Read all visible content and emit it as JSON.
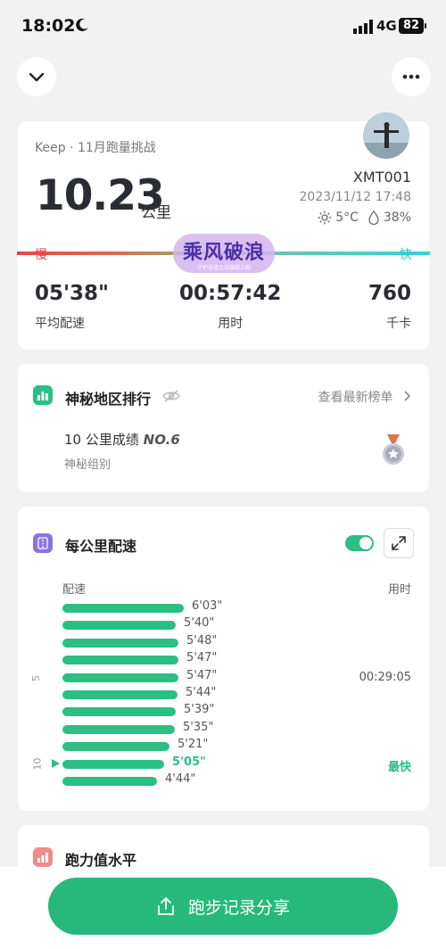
{
  "status_bar": {
    "time": "18:02",
    "network": "4G",
    "battery": "82"
  },
  "summary": {
    "challenge": "Keep · 11月跑量挑战",
    "distance": "10.23",
    "unit": "公里",
    "user": "XMT001",
    "datetime": "2023/11/12 17:48",
    "temperature": "5°C",
    "humidity": "38%",
    "slow_label": "慢",
    "fast_label": "快",
    "watermark_main": "乘风破浪",
    "watermark_sub": "守护谷道之云端线上跑",
    "stats": [
      {
        "value": "05'38\"",
        "label": "平均配速"
      },
      {
        "value": "00:57:42",
        "label": "用时"
      },
      {
        "value": "760",
        "label": "千卡"
      }
    ]
  },
  "ranking": {
    "title": "神秘地区排行",
    "link": "查看最新榜单",
    "result_prefix": "10 公里成绩",
    "result_no": "NO.6",
    "group": "神秘组别"
  },
  "pace": {
    "title": "每公里配速",
    "col_pace": "配速",
    "col_time": "用时",
    "km_marks": [
      "5",
      "10"
    ],
    "split_time": "00:29:05",
    "fastest_label": "最快",
    "splits": [
      {
        "pace": "6'03\"",
        "seconds": 363
      },
      {
        "pace": "5'40\"",
        "seconds": 340
      },
      {
        "pace": "5'48\"",
        "seconds": 348
      },
      {
        "pace": "5'47\"",
        "seconds": 347
      },
      {
        "pace": "5'47\"",
        "seconds": 347
      },
      {
        "pace": "5'44\"",
        "seconds": 344
      },
      {
        "pace": "5'39\"",
        "seconds": 339
      },
      {
        "pace": "5'35\"",
        "seconds": 335
      },
      {
        "pace": "5'21\"",
        "seconds": 321
      },
      {
        "pace": "5'05\"",
        "seconds": 305,
        "fastest": true
      },
      {
        "pace": "4'44\"",
        "seconds": 284
      }
    ],
    "accent_color": "#2bbf83"
  },
  "power": {
    "title": "跑力值水平"
  },
  "share": {
    "label": "跑步记录分享"
  },
  "icons": [
    "moon-icon",
    "signal-icon",
    "chevron-down-icon",
    "more-icon",
    "sun-icon",
    "drop-icon",
    "bar-chart-icon",
    "eye-off-icon",
    "chevron-right-icon",
    "medal-icon",
    "road-icon",
    "expand-icon",
    "share-icon"
  ]
}
